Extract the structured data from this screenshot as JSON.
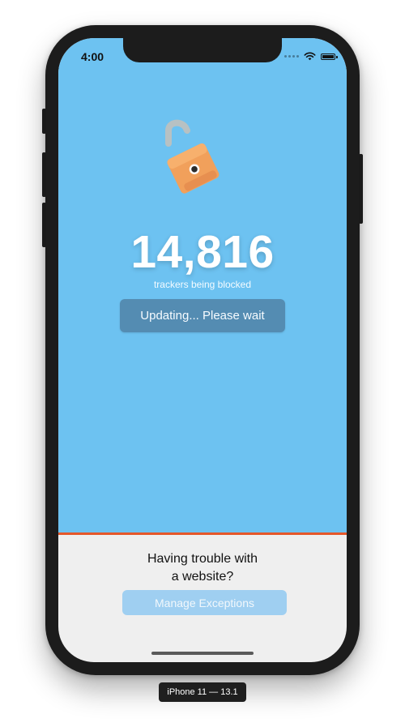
{
  "status_bar": {
    "time": "4:00",
    "icons": [
      "signal-dots-icon",
      "wifi-icon",
      "battery-icon"
    ]
  },
  "hero": {
    "icon": "unlocked-padlock-icon",
    "count": "14,816",
    "count_label": "trackers being blocked"
  },
  "actions": {
    "updating_label": "Updating... Please wait",
    "manage_label": "Manage Exceptions"
  },
  "help": {
    "line1": "Having trouble with",
    "line2": "a website?"
  },
  "device_label": "iPhone 11 — 13.1",
  "colors": {
    "background_blue": "#6dc2f1",
    "accent_orange": "#e5572a",
    "button_blue": "#548cb2",
    "button_light_blue": "#9fcff1",
    "panel_gray": "#efefef"
  }
}
